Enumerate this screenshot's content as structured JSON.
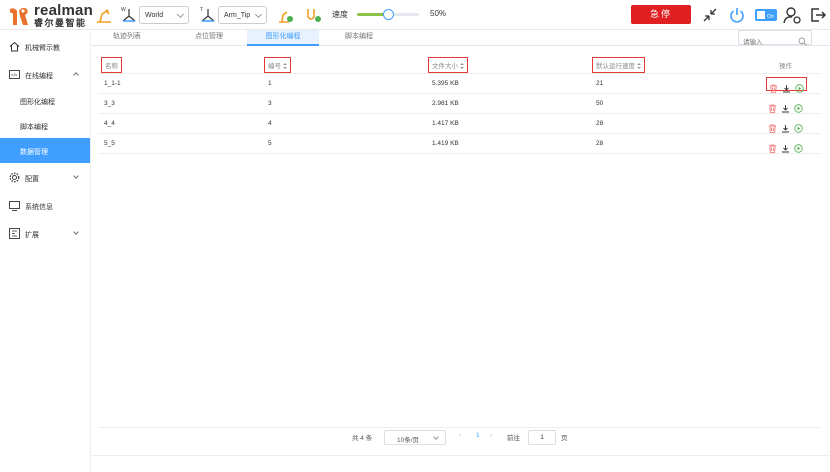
{
  "brand": {
    "name_en": "realman",
    "name_cn": "睿尔曼智能"
  },
  "toolbar": {
    "coord_frame": "World",
    "tool_frame": "Arm_Tip",
    "speed_label": "速度",
    "speed_value": "50%",
    "speed_fraction": 0.5,
    "estop_label": "急停",
    "toggle_label": "On"
  },
  "sidebar": {
    "items": [
      {
        "label": "机械臂示教",
        "icon": "robot-arm-home-icon"
      },
      {
        "label": "在线编程",
        "icon": "code-icon",
        "expanded": true
      },
      {
        "label": "图形化编程",
        "sub": true
      },
      {
        "label": "脚本编程",
        "sub": true
      },
      {
        "label": "数据管理",
        "sub": true,
        "active": true
      },
      {
        "label": "配置",
        "icon": "gear-icon"
      },
      {
        "label": "系统信息",
        "icon": "monitor-icon"
      },
      {
        "label": "扩展",
        "icon": "extension-icon"
      }
    ]
  },
  "tabs": [
    "轨迹列表",
    "点位管理",
    "图形化编程",
    "脚本编程"
  ],
  "active_tab": 2,
  "search": {
    "placeholder": "请输入"
  },
  "table": {
    "headers": {
      "name": "名称",
      "id": "编号",
      "size": "文件大小",
      "speed": "默认运行速度",
      "actions": "操作"
    },
    "rows": [
      {
        "name": "1_1-1",
        "id": "1",
        "size": "5.395 KB",
        "speed": "21"
      },
      {
        "name": "3_3",
        "id": "3",
        "size": "2.981 KB",
        "speed": "50"
      },
      {
        "name": "4_4",
        "id": "4",
        "size": "1.417 KB",
        "speed": "28"
      },
      {
        "name": "5_5",
        "id": "5",
        "size": "1.419 KB",
        "speed": "28"
      }
    ]
  },
  "pagination": {
    "total": "共 4 条",
    "page_size": "10条/页",
    "current_page": "1",
    "goto_label": "前往",
    "goto_value": "1",
    "page_suffix": "页"
  },
  "colors": {
    "accent": "#409eff",
    "danger": "#e02020",
    "highlight": "#e53935",
    "play": "#4caf50"
  }
}
